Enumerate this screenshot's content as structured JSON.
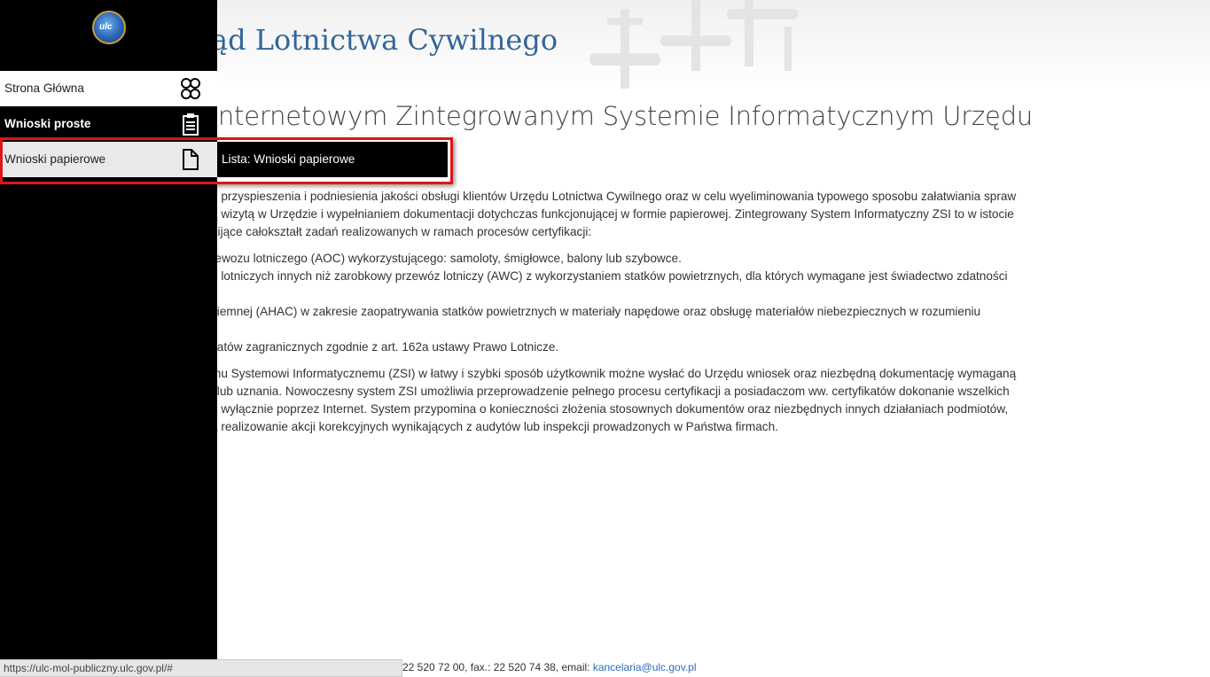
{
  "header": {
    "site_title": "ąd Lotnictwa Cywilnego",
    "logo_text": "ulc"
  },
  "main": {
    "heading": "internetowym Zintegrowanym Systemie Informatycznym Urzędu",
    "paragraphs": [
      "u przyspieszenia i podniesienia jakości obsługi klientów Urzędu Lotnictwa Cywilnego oraz w celu wyeliminowania typowego sposobu załatwiania spraw",
      "ą wizytą w Urzędzie i wypełnianiem dokumentacji dotychczas funkcjonującej w formie papierowej. Zintegrowany System Informatyczny ZSI to w istocie",
      "pijące całokształt zadań realizowanych w ramach procesów certyfikacji:",
      "rewozu lotniczego (AOC) wykorzystującego: samoloty, śmigłowce, balony lub szybowce.",
      "g lotniczych innych niż zarobkowy przewóz lotniczy (AWC) z wykorzystaniem statków powietrznych, dla których wymagane jest świadectwo zdatności",
      "ziemnej (AHAC) w zakresie zaopatrywania statków powietrznych w materiały napędowe oraz obsługę materiałów niebezpiecznych w rozumieniu",
      "katów zagranicznych zgodnie z art. 162a ustawy Prawo Lotnicze.",
      "mu Systemowi Informatycznemu (ZSI) w łatwy i szybki sposób użytkownik możne wysłać do Urzędu wniosek oraz niezbędną dokumentację wymaganą",
      "i lub uznania. Nowoczesny system ZSI umożliwia przeprowadzenie pełnego procesu certyfikacji a posiadaczom ww. certyfikatów dokonanie wszelkich",
      "ę wyłącznie poprzez Internet. System przypomina o konieczności złożenia stosownych dokumentów oraz niezbędnych innych działaniach podmiotów,",
      "a realizowanie akcji korekcyjnych wynikających z audytów lub inspekcji prowadzonych w Państwa firmach."
    ]
  },
  "sidebar": {
    "items": [
      {
        "label": "Strona Główna",
        "icon": "network-icon"
      },
      {
        "label": "Wnioski proste",
        "icon": "clipboard-icon"
      },
      {
        "label": "Wnioski papierowe",
        "icon": "document-icon"
      }
    ],
    "flyout_label": "Lista: Wnioski papierowe"
  },
  "footer": {
    "contact": "22 520 72 00, fax.: 22 520 74 38, email: ",
    "email": "kancelaria@ulc.gov.pl"
  },
  "status_bar": {
    "url": "https://ulc-mol-publiczny.ulc.gov.pl/#"
  },
  "colors": {
    "highlight": "#e01515",
    "title": "#336699",
    "link": "#2a6ebb"
  }
}
